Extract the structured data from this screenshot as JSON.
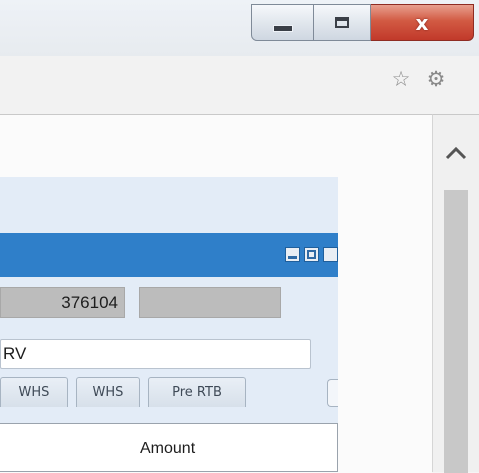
{
  "window_controls": {
    "minimize_icon": "minimize-icon",
    "maximize_icon": "maximize-icon",
    "close_glyph": "x",
    "close_color": "#c94a37"
  },
  "toolbar": {
    "bookmark_icon": "star-icon",
    "settings_icon": "gear-icon"
  },
  "app": {
    "titlebar_color": "#2f7fc9",
    "number_field_value": "376104",
    "text_field_value": "RV",
    "tabs": [
      "WHS",
      "WHS",
      "Pre RTB"
    ],
    "grid": {
      "columns": [
        "Amount"
      ]
    }
  }
}
